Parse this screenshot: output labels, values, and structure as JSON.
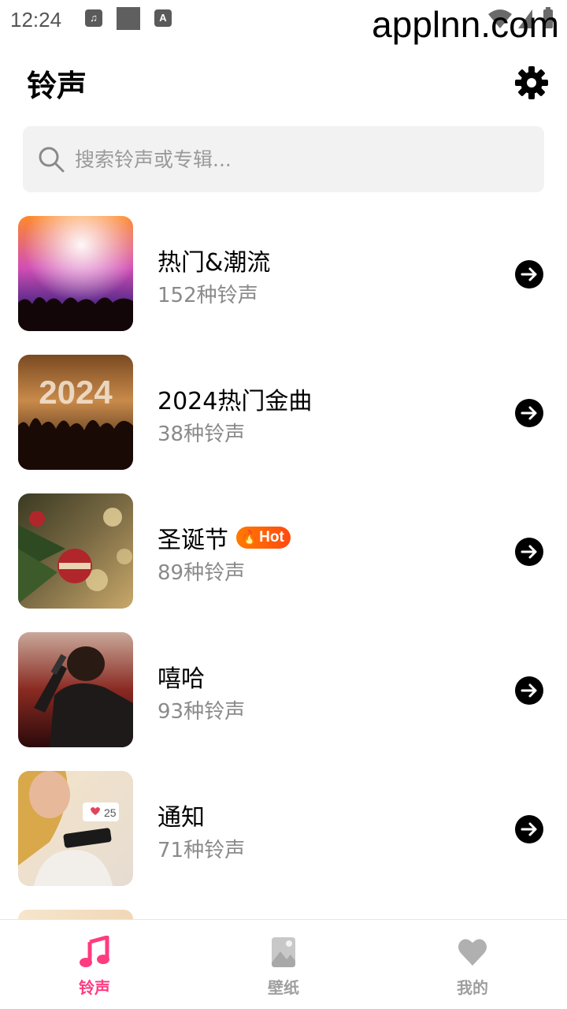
{
  "status_bar": {
    "time": "12:24",
    "watermark": "applnn.com",
    "icons": [
      "music-note-icon",
      "notification-square-icon",
      "keyboard-a-icon",
      "wifi-icon",
      "signal-icon",
      "battery-icon"
    ]
  },
  "header": {
    "title": "铃声",
    "settings_icon": "gear-icon"
  },
  "search": {
    "placeholder": "搜索铃声或专辑..."
  },
  "categories": [
    {
      "title": "热门&潮流",
      "count": "152种铃声",
      "badge": "",
      "thumb": "concert-lights"
    },
    {
      "title": "2024热门金曲",
      "count": "38种铃声",
      "badge": "",
      "thumb": "2024-crowd",
      "thumb_text": "2024"
    },
    {
      "title": "圣诞节",
      "count": "89种铃声",
      "badge": "Hot",
      "thumb": "christmas-ornament"
    },
    {
      "title": "嘻哈",
      "count": "93种铃声",
      "badge": "",
      "thumb": "hiphop-singer"
    },
    {
      "title": "通知",
      "count": "71种铃声",
      "badge": "",
      "thumb": "phone-notification",
      "thumb_text": "25"
    }
  ],
  "bottom_nav": [
    {
      "label": "铃声",
      "icon": "music-note-icon",
      "active": true
    },
    {
      "label": "壁纸",
      "icon": "image-icon",
      "active": false
    },
    {
      "label": "我的",
      "icon": "heart-icon",
      "active": false
    }
  ],
  "colors": {
    "accent": "#ff3b7f",
    "hot_badge": "#ff5a10",
    "muted_text": "#8a8a8a",
    "search_bg": "#f2f2f2"
  }
}
